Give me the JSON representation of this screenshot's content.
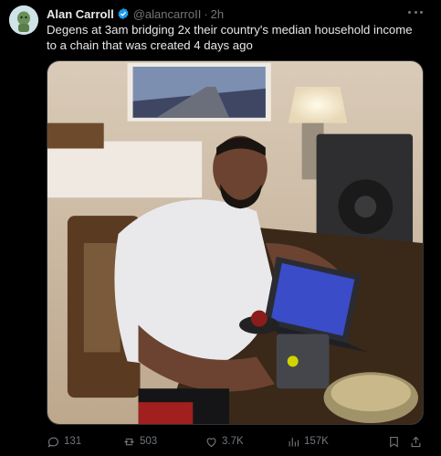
{
  "tweet": {
    "author_name": "Alan Carroll",
    "author_handle": "@alancarroII",
    "separator": "·",
    "time_ago": "2h",
    "text": "Degens at 3am bridging 2x their country's median household income to a chain that was created 4 days ago"
  },
  "actions": {
    "replies": "131",
    "reposts": "503",
    "likes": "3.7K",
    "views": "157K"
  },
  "colors": {
    "background": "#000000",
    "primary_text": "#e7e9ea",
    "secondary_text": "#71767b",
    "verified_badge": "#1d9bf0"
  },
  "icons": [
    "more-icon",
    "verified-icon",
    "reply-icon",
    "repost-icon",
    "like-icon",
    "views-icon",
    "bookmark-icon",
    "share-icon"
  ]
}
